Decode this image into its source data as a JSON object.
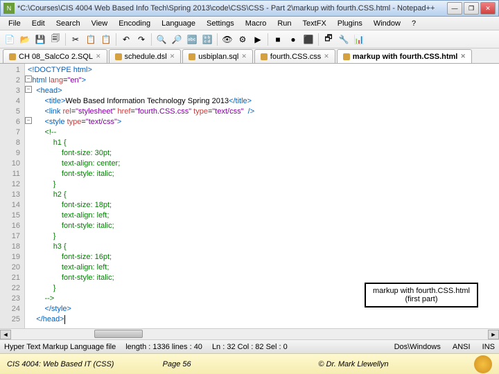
{
  "window": {
    "title": "*C:\\Courses\\CIS 4004  Web Based Info Tech\\Spring 2013\\code\\CSS\\CSS - Part 2\\markup with fourth.CSS.html - Notepad++"
  },
  "winbtns": {
    "min": "—",
    "max": "❐",
    "close": "✕"
  },
  "menu": [
    "File",
    "Edit",
    "Search",
    "View",
    "Encoding",
    "Language",
    "Settings",
    "Macro",
    "Run",
    "TextFX",
    "Plugins",
    "Window",
    "?"
  ],
  "tabs": [
    {
      "label": "CH 08_SalcCo 2.SQL"
    },
    {
      "label": "schedule.dsl"
    },
    {
      "label": "usbiplan.sql"
    },
    {
      "label": "fourth.CSS.css"
    },
    {
      "label": "markup with fourth.CSS.html",
      "active": true
    }
  ],
  "code": {
    "lines": [
      {
        "n": 1,
        "html": "<span class='c-blue'>&lt;!DOCTYPE html&gt;</span>"
      },
      {
        "n": 2,
        "html": "<span class='c-blue'>&lt;html</span> <span class='c-red'>lang</span>=<span class='c-purple'>\"en\"</span><span class='c-blue'>&gt;</span>"
      },
      {
        "n": 3,
        "html": "    <span class='c-blue'>&lt;head&gt;</span>"
      },
      {
        "n": 4,
        "html": "        <span class='c-blue'>&lt;title&gt;</span>Web Based Information Technology Spring 2013<span class='c-blue'>&lt;/title&gt;</span>"
      },
      {
        "n": 5,
        "html": "        <span class='c-blue'>&lt;link</span> <span class='c-red'>rel</span>=<span class='c-purple'>\"stylesheet\"</span> <span class='c-red'>href</span>=<span class='c-purple'>\"fourth.CSS.css\"</span> <span class='c-red'>type</span>=<span class='c-purple'>\"text/css\"</span>  <span class='c-blue'>/&gt;</span>"
      },
      {
        "n": 6,
        "html": "        <span class='c-blue'>&lt;style</span> <span class='c-red'>type</span>=<span class='c-purple'>\"text/css\"</span><span class='c-blue'>&gt;</span>"
      },
      {
        "n": 7,
        "html": "        <span class='c-green'>&lt;!--</span>"
      },
      {
        "n": 8,
        "html": "            <span class='c-green'>h1 {</span>"
      },
      {
        "n": 9,
        "html": "                <span class='c-green'>font-size: 30pt;</span>"
      },
      {
        "n": 10,
        "html": "                <span class='c-green'>text-align: center;</span>"
      },
      {
        "n": 11,
        "html": "                <span class='c-green'>font-style: italic;</span>"
      },
      {
        "n": 12,
        "html": "            <span class='c-green'>}</span>"
      },
      {
        "n": 13,
        "html": "            <span class='c-green'>h2 {</span>"
      },
      {
        "n": 14,
        "html": "                <span class='c-green'>font-size: 18pt;</span>"
      },
      {
        "n": 15,
        "html": "                <span class='c-green'>text-align: left;</span>"
      },
      {
        "n": 16,
        "html": "                <span class='c-green'>font-style: italic;</span>"
      },
      {
        "n": 17,
        "html": "            <span class='c-green'>}</span>"
      },
      {
        "n": 18,
        "html": "            <span class='c-green'>h3 {</span>"
      },
      {
        "n": 19,
        "html": "                <span class='c-green'>font-size: 16pt;</span>"
      },
      {
        "n": 20,
        "html": "                <span class='c-green'>text-align: left;</span>"
      },
      {
        "n": 21,
        "html": "                <span class='c-green'>font-style: italic;</span>"
      },
      {
        "n": 22,
        "html": "            <span class='c-green'>}</span>"
      },
      {
        "n": 23,
        "html": "        <span class='c-green'>--&gt;</span>"
      },
      {
        "n": 24,
        "html": "        <span class='c-blue'>&lt;/style&gt;</span>"
      },
      {
        "n": 25,
        "html": "    <span class='c-blue'>&lt;/head&gt;</span><span class='caret'></span>"
      }
    ]
  },
  "callout": {
    "l1": "markup with fourth.CSS.html",
    "l2": "(first part)"
  },
  "status": {
    "type": "Hyper Text Markup Language file",
    "length": "length : 1336   lines : 40",
    "pos": "Ln : 32   Col : 82   Sel : 0",
    "eol": "Dos\\Windows",
    "enc": "ANSI",
    "ins": "INS"
  },
  "footer": {
    "left": "CIS 4004: Web Based IT (CSS)",
    "center": "Page 56",
    "right": "© Dr. Mark Llewellyn"
  },
  "toolbar_icons": [
    "📄",
    "📂",
    "💾",
    "🗐",
    "✂",
    "📋",
    "📋",
    "↶",
    "↷",
    "🔍",
    "🔎",
    "🔤",
    "🔡",
    "👁",
    "⚙",
    "▶",
    "■",
    "●",
    "⬛",
    "🗗",
    "🔧",
    "📊"
  ]
}
